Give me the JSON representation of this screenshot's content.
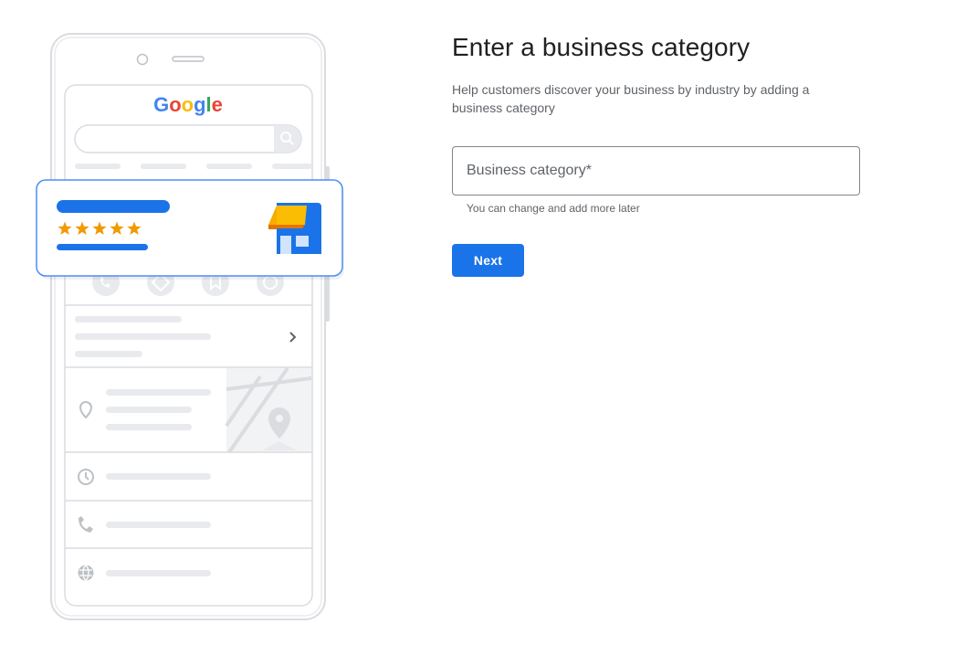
{
  "illustration": {
    "logo_text": "Google",
    "logo_colors": [
      "#4285F4",
      "#EA4335",
      "#FBBC05",
      "#4285F4",
      "#34A853",
      "#EA4335"
    ],
    "rating_stars": 5,
    "rating_color": "#F29900",
    "accent_color": "#1A73E8",
    "action_icons": [
      "phone-icon",
      "directions-icon",
      "bookmark-icon",
      "website-icon"
    ],
    "detail_icons": [
      "location-pin-icon",
      "clock-icon",
      "phone-icon",
      "globe-icon"
    ]
  },
  "form": {
    "title": "Enter a business category",
    "subtitle": "Help customers discover your business by industry by adding a business category",
    "field_placeholder": "Business category*",
    "field_value": "",
    "helper_text": "You can change and add more later",
    "next_label": "Next"
  },
  "colors": {
    "primary_button": "#1a73e8",
    "field_border": "#80868b",
    "text_primary": "#202124",
    "text_secondary": "#5f6368"
  }
}
